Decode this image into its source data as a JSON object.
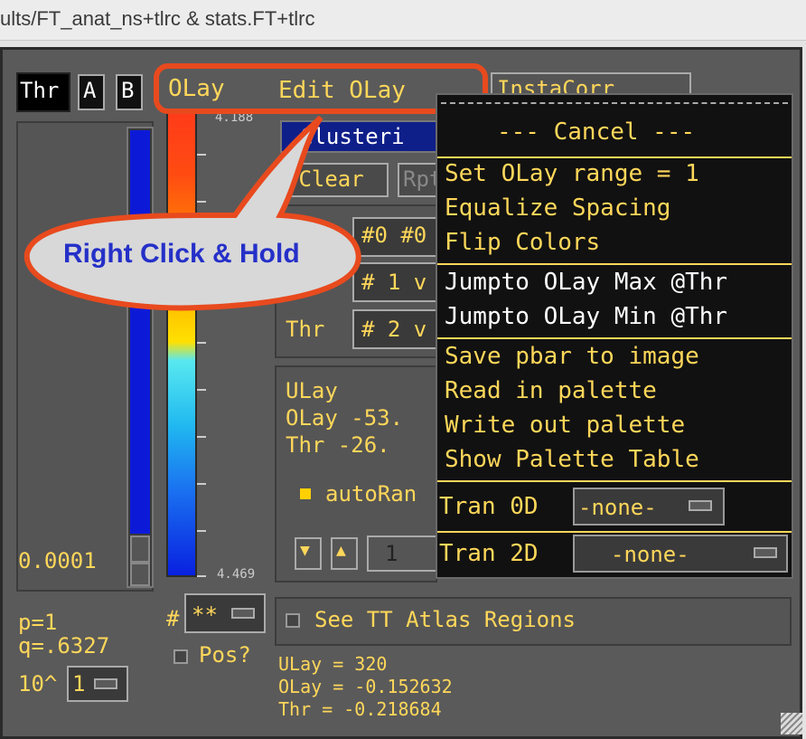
{
  "window": {
    "title": "ults/FT_anat_ns+tlrc & stats.FT+tlrc"
  },
  "top_buttons": {
    "thr": "Thr",
    "a": "A",
    "b": "B",
    "olay": "OLay",
    "edit_olay": "Edit OLay",
    "instacorr": "InstaCorr"
  },
  "pbar": {
    "top_value": "4.188",
    "bottom_value": "4.469"
  },
  "threshold": {
    "value": "0.0001",
    "p": "p=1",
    "q": "q=.6327",
    "exp_label": "10^",
    "exp_value": "1"
  },
  "hash_menu": {
    "hash": "#",
    "value": "**"
  },
  "pos_label": "Pos?",
  "clusterize": {
    "label": "Clusteri",
    "clear": "*Clear",
    "rpt": "Rpt"
  },
  "sub_rows": [
    {
      "label": "",
      "value": "#0 #0"
    },
    {
      "label": "",
      "value": "# 1 v"
    },
    {
      "label": "Thr",
      "value": "# 2 v"
    }
  ],
  "info": {
    "ulay": "ULay",
    "olay": "OLay -53.",
    "thr": "Thr  -26."
  },
  "autorange": "autoRan",
  "range_field": "1",
  "see_tt": "See TT Atlas Regions",
  "readout": {
    "ulay": "ULay = 320",
    "olay": "OLay = -0.152632",
    "thr": "Thr  = -0.218684"
  },
  "callout": "Right Click & Hold",
  "menu": {
    "cancel": "--- Cancel ---",
    "items": [
      "Set OLay range = 1",
      "Equalize Spacing",
      "Flip Colors",
      "Jumpto OLay Max @Thr",
      "Jumpto OLay Min @Thr",
      "Save pbar to image",
      "Read in palette",
      "Write out palette",
      "Show Palette Table"
    ],
    "tran0d_label": "Tran 0D",
    "tran0d_value": "-none-",
    "tran2d_label": "Tran 2D",
    "tran2d_value": "-none-"
  },
  "colors": {
    "text": "#ffd75a",
    "callout_border": "#e84a1e",
    "callout_text": "#2530c8"
  }
}
